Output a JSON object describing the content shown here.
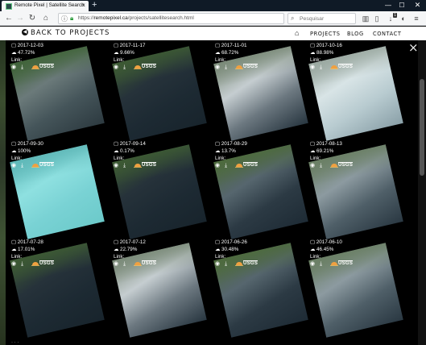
{
  "browser": {
    "tab_title": "Remote Pixel | Satellite Search",
    "tab_close": "×",
    "new_tab": "+",
    "url_prefix": "https://",
    "url_domain": "remotepixel.ca",
    "url_path": "/projects/satellitesearch.html",
    "search_placeholder": "Pesquisar",
    "downloads_badge": "1",
    "window_min": "—",
    "window_max": "☐",
    "window_close": "✕"
  },
  "site": {
    "back_label": "BACK TO PROJECTS",
    "nav": [
      "PROJECTS",
      "BLOG",
      "CONTACT"
    ],
    "close_overlay": "×"
  },
  "cards": [
    {
      "date": "2017-12-03",
      "cloud": "47.72%",
      "link": "Link:",
      "scene": "light"
    },
    {
      "date": "2017-11-17",
      "cloud": "9.66%",
      "link": "Link:",
      "scene": "dark"
    },
    {
      "date": "2017-11-01",
      "cloud": "68.72%",
      "link": "Link:",
      "scene": "cloudy"
    },
    {
      "date": "2017-10-16",
      "cloud": "88.98%",
      "link": "Link:",
      "scene": "white"
    },
    {
      "date": "2017-09-30",
      "cloud": "100%",
      "link": "Link:",
      "scene": "cyan"
    },
    {
      "date": "2017-09-14",
      "cloud": "0.17%",
      "link": "Link:",
      "scene": "dark"
    },
    {
      "date": "2017-08-29",
      "cloud": "13.7%",
      "link": "Link:",
      "scene": "mixed"
    },
    {
      "date": "2017-08-13",
      "cloud": "69.21%",
      "link": "Link:",
      "scene": "haze"
    },
    {
      "date": "2017-07-28",
      "cloud": "17.01%",
      "link": "Link:",
      "scene": "dark"
    },
    {
      "date": "2017-07-12",
      "cloud": "22.79%",
      "link": "Link:",
      "scene": "cloudy"
    },
    {
      "date": "2017-06-26",
      "cloud": "30.48%",
      "link": "Link:",
      "scene": "mixed"
    },
    {
      "date": "2017-06-10",
      "cloud": "46.45%",
      "link": "Link:",
      "scene": "haze"
    }
  ],
  "provider_label": "USGS",
  "colors": {
    "chrome_dark": "#0f1a26",
    "star": "#2b7bd8",
    "page_bg": "#000000",
    "header_bg": "#ffffff"
  }
}
